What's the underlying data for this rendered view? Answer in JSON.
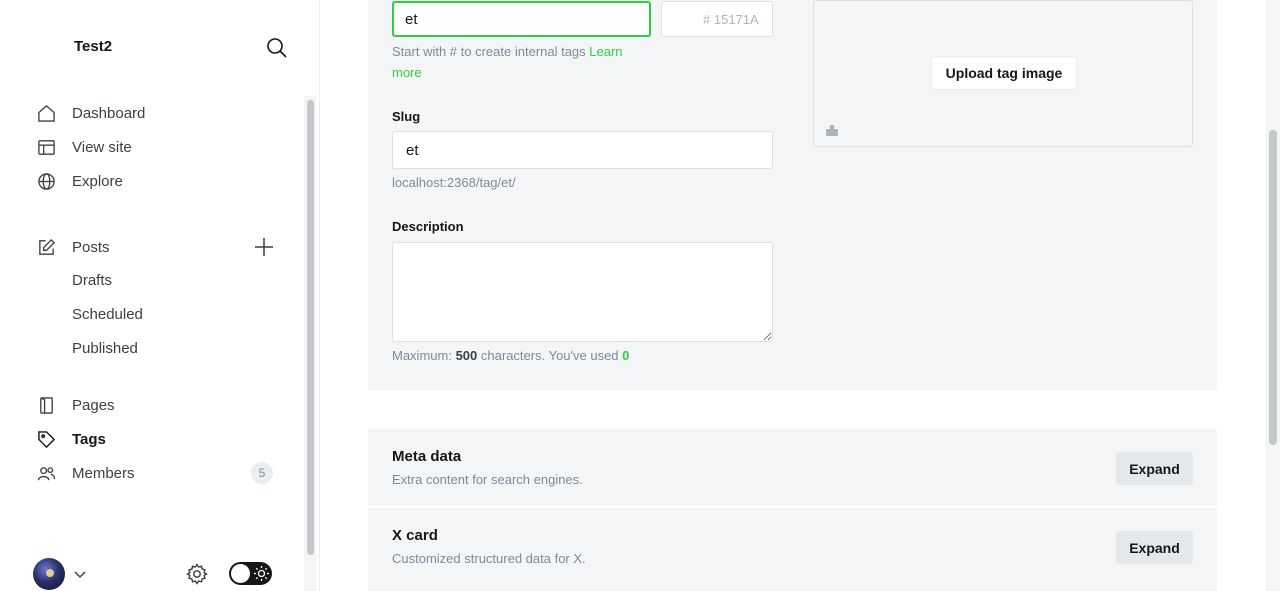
{
  "sidebar": {
    "site_title": "Test2",
    "nav": {
      "dashboard": "Dashboard",
      "view_site": "View site",
      "explore": "Explore",
      "posts": "Posts",
      "drafts": "Drafts",
      "scheduled": "Scheduled",
      "published": "Published",
      "pages": "Pages",
      "tags": "Tags",
      "members": "Members",
      "members_count": "5"
    },
    "icons": [
      "search-icon",
      "home-icon",
      "layout-icon",
      "globe-icon",
      "edit-icon",
      "plus-icon",
      "page-icon",
      "tag-icon",
      "members-icon",
      "gear-icon",
      "chevron-down-icon",
      "sun-icon"
    ]
  },
  "tag_form": {
    "name_value": "et",
    "color_placeholder": "15171A",
    "color_prefix": "#",
    "name_hint": "Start with # to create internal tags",
    "learn_more": "Learn more",
    "slug_label": "Slug",
    "slug_value": "et",
    "slug_url": "localhost:2368/tag/et/",
    "description_label": "Description",
    "description_value": "",
    "desc_hint_prefix": "Maximum:",
    "desc_max": "500",
    "desc_hint_mid": "characters. You've used",
    "desc_used": "0",
    "upload_label": "Upload tag image"
  },
  "sections": {
    "meta": {
      "title": "Meta data",
      "description": "Extra content for search engines.",
      "button": "Expand"
    },
    "xcard": {
      "title": "X card",
      "description": "Customized structured data for X.",
      "button": "Expand"
    }
  },
  "colors": {
    "accent": "#30cf43",
    "text": "#15171a",
    "muted": "#7c8b9a",
    "card_bg": "#f4f5f6"
  }
}
